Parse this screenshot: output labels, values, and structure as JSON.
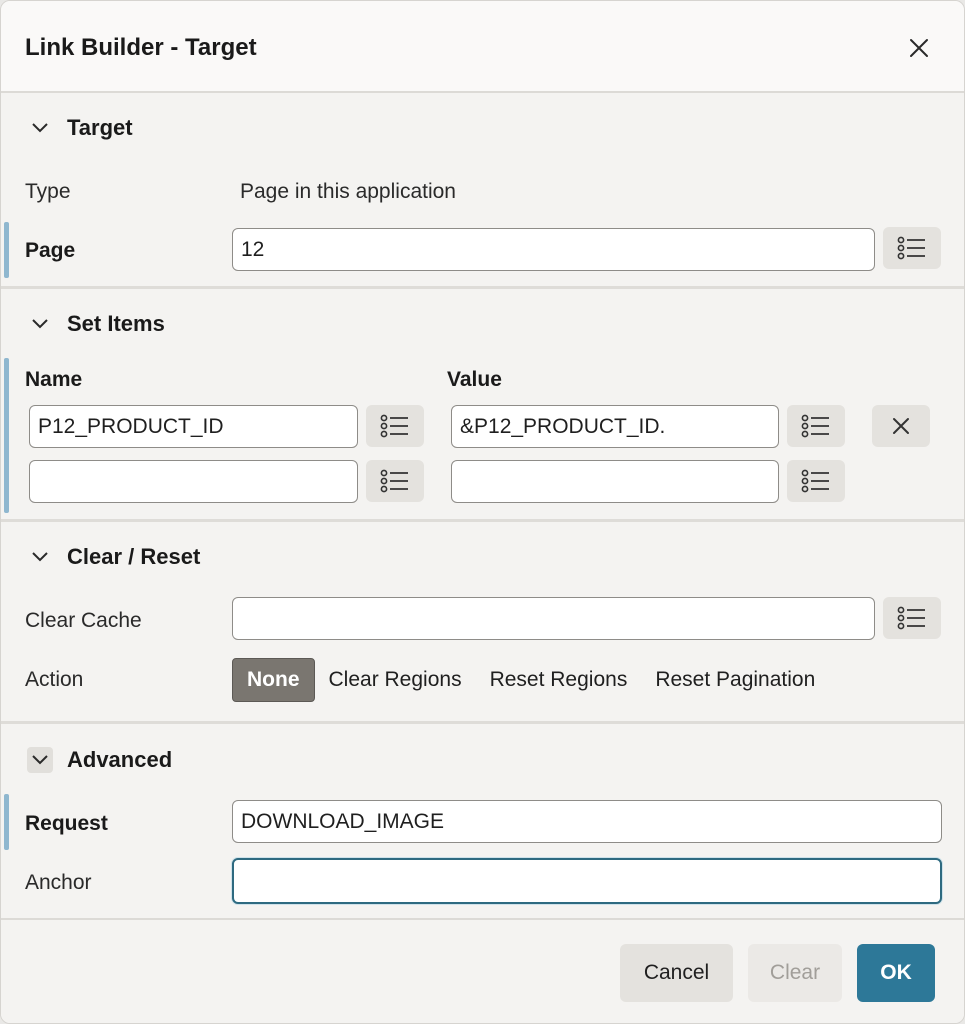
{
  "dialog": {
    "title": "Link Builder - Target"
  },
  "target": {
    "header": "Target",
    "type_label": "Type",
    "type_value": "Page in this application",
    "page_label": "Page",
    "page_value": "12"
  },
  "set_items": {
    "header": "Set Items",
    "name_label": "Name",
    "value_label": "Value",
    "rows": [
      {
        "name": "P12_PRODUCT_ID",
        "value": "&P12_PRODUCT_ID."
      },
      {
        "name": "",
        "value": ""
      }
    ]
  },
  "clear_reset": {
    "header": "Clear / Reset",
    "clear_cache_label": "Clear Cache",
    "clear_cache_value": "",
    "action_label": "Action",
    "action_options": [
      "None",
      "Clear Regions",
      "Reset Regions",
      "Reset Pagination"
    ],
    "action_selected": "None"
  },
  "advanced": {
    "header": "Advanced",
    "request_label": "Request",
    "request_value": "DOWNLOAD_IMAGE",
    "anchor_label": "Anchor",
    "anchor_value": ""
  },
  "footer": {
    "cancel_label": "Cancel",
    "clear_label": "Clear",
    "ok_label": "OK"
  },
  "icons": {
    "close": "close-icon",
    "chevron": "chevron-down-icon",
    "list": "list-icon",
    "remove": "remove-icon"
  },
  "colors": {
    "primary": "#2d7898",
    "required_bar": "#8fb7cf",
    "selected_option": "#7a7670"
  }
}
